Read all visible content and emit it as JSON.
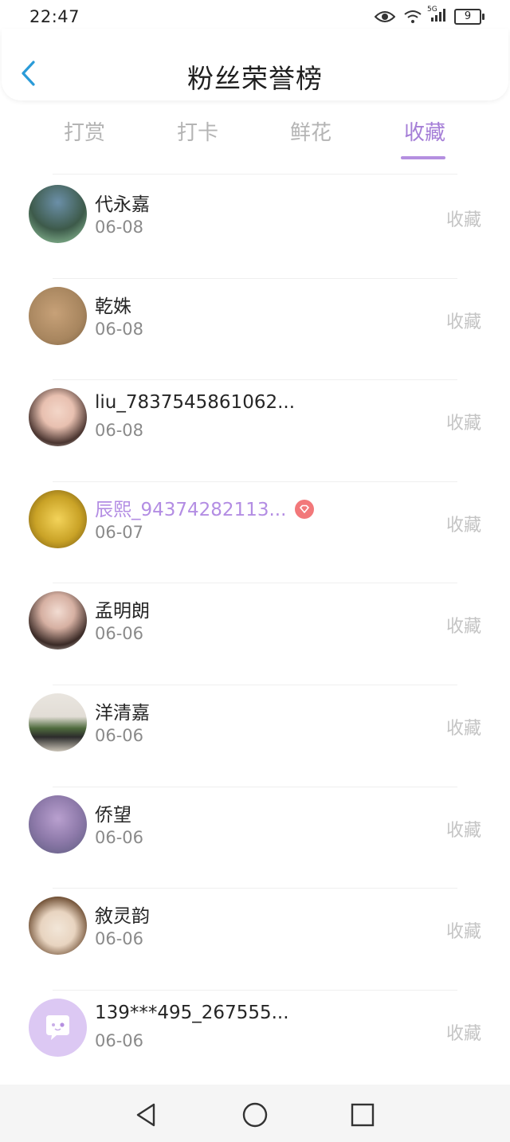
{
  "status_bar": {
    "time": "22:47",
    "network_label": "5G",
    "battery_level": "9",
    "icons": [
      "eye-icon",
      "wifi-icon",
      "signal-icon",
      "battery-icon"
    ]
  },
  "header": {
    "title": "粉丝荣誉榜",
    "back_icon": "chevron-left-icon"
  },
  "tabs": [
    {
      "label": "打赏",
      "active": false
    },
    {
      "label": "打卡",
      "active": false
    },
    {
      "label": "鲜花",
      "active": false
    },
    {
      "label": "收藏",
      "active": true
    }
  ],
  "colors": {
    "accent": "#a57ed7",
    "vip_name": "#b38de3",
    "vip_badge": "#f2787a",
    "muted": "#c4c4c4"
  },
  "fans": [
    {
      "name": "代永嘉",
      "date": "06-08",
      "tag": "收藏",
      "vip": false
    },
    {
      "name": "乾姝",
      "date": "06-08",
      "tag": "收藏",
      "vip": false
    },
    {
      "name": "liu_7837545861062...",
      "date": "06-08",
      "tag": "收藏",
      "vip": false
    },
    {
      "name": "辰熙_94374282113...",
      "date": "06-07",
      "tag": "收藏",
      "vip": true
    },
    {
      "name": "孟明朗",
      "date": "06-06",
      "tag": "收藏",
      "vip": false
    },
    {
      "name": "洋清嘉",
      "date": "06-06",
      "tag": "收藏",
      "vip": false
    },
    {
      "name": "侨望",
      "date": "06-06",
      "tag": "收藏",
      "vip": false
    },
    {
      "name": "敘灵韵",
      "date": "06-06",
      "tag": "收藏",
      "vip": false
    },
    {
      "name": "139***495_267555...",
      "date": "06-06",
      "tag": "收藏",
      "vip": false
    }
  ],
  "nav": [
    "back-triangle-icon",
    "home-circle-icon",
    "recents-square-icon"
  ]
}
